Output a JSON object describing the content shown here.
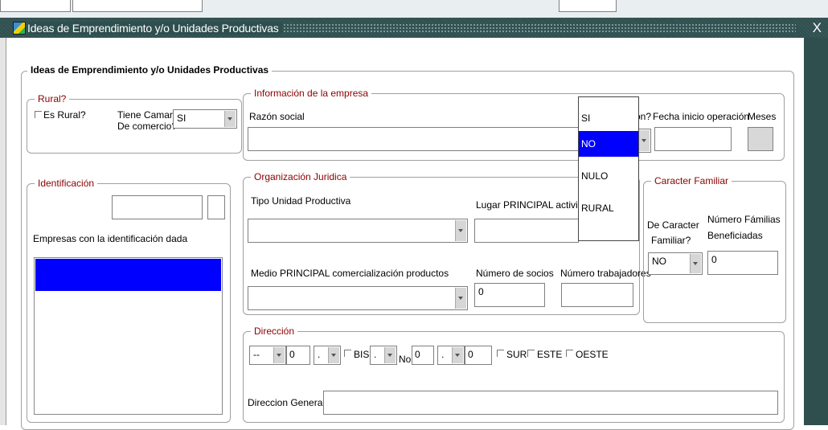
{
  "window": {
    "title": "Ideas de Emprendimiento y/o Unidades Productivas",
    "close_label": "X"
  },
  "main": {
    "section_title": "Ideas de Emprendimiento y/o Unidades Productivas"
  },
  "rural": {
    "legend": "Rural?",
    "es_rural_label": "Es Rural?",
    "tiene_camara_label_1": "Tiene Camara",
    "tiene_camara_label_2": "De comercio?",
    "tiene_camara_value": "SI"
  },
  "empresa": {
    "legend": "Información de la empresa",
    "razon_social_label": "Razón social",
    "razon_social_value": "",
    "hidden_label_suffix": "ón?",
    "fecha_inicio_label": "Fecha inicio operación",
    "meses_label": "Meses"
  },
  "dropdown": {
    "options": [
      "SI",
      "NO",
      "NULO",
      "RURAL"
    ],
    "selected": "NO"
  },
  "identificacion": {
    "legend": "Identificación",
    "empresas_label": "Empresas con la identificación dada"
  },
  "organizacion": {
    "legend": "Organización Juridica",
    "tipo_unidad_label": "Tipo Unidad Productiva",
    "lugar_label": "Lugar PRINCIPAL actividad",
    "medio_label": "Medio PRINCIPAL comercialización productos",
    "numero_socios_label": "Número de socios",
    "numero_socios_value": "0",
    "numero_trabajadores_label": "Número trabajadores"
  },
  "familiar": {
    "legend": "Caracter Familiar",
    "de_caracter_label_1": "De Caracter",
    "de_caracter_label_2": "Familiar?",
    "de_caracter_value": "NO",
    "numero_familias_label_1": "Número Fámilias",
    "numero_familias_label_2": "Beneficiadas",
    "numero_familias_value": "0"
  },
  "direccion": {
    "legend": "Dirección",
    "via_value": "--",
    "num1_value": "0",
    "letra1_value": ".",
    "bis_label": "BIS",
    "letra2_value": ".",
    "no_label": "No",
    "num2_value": "0",
    "letra3_value": ".",
    "num3_value": "0",
    "sur_label": "SUR",
    "este_label": "ESTE",
    "oeste_label": "OESTE",
    "generada_label": "Direccion Generada",
    "generada_value": ""
  }
}
